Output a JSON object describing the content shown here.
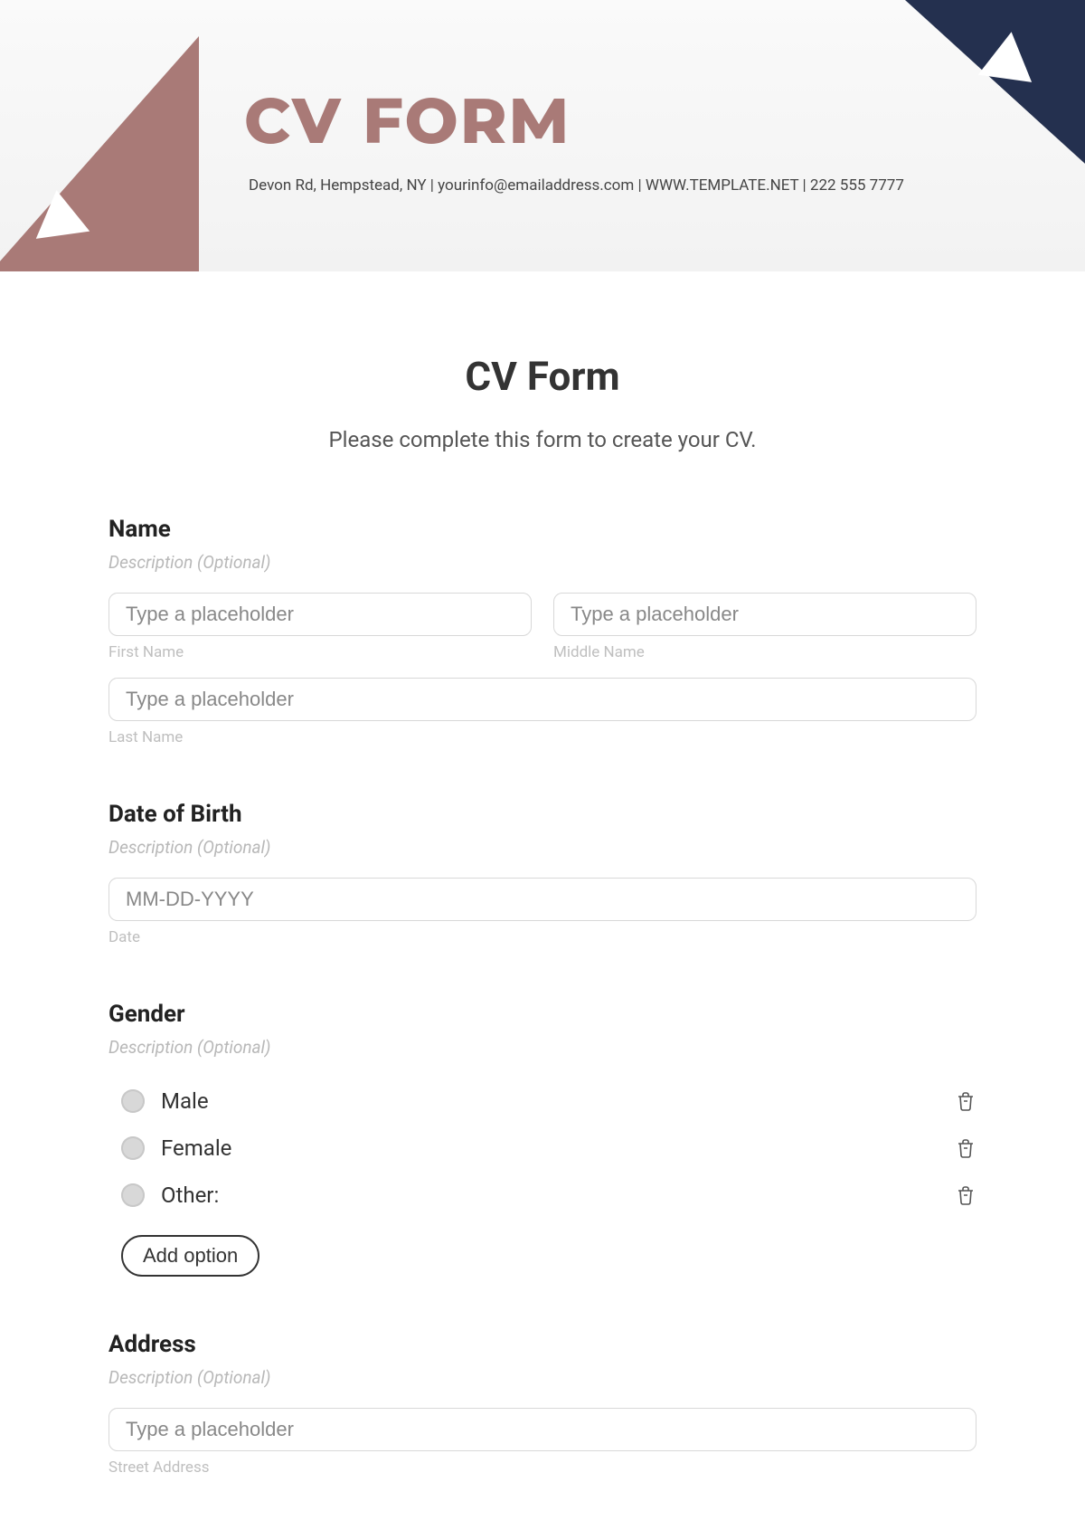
{
  "banner": {
    "title": "CV FORM",
    "sub": "Devon Rd, Hempstead, NY | yourinfo@emailaddress.com | WWW.TEMPLATE.NET | 222 555 7777"
  },
  "form": {
    "title": "CV Form",
    "sub": "Please complete this form to create your CV."
  },
  "name": {
    "label": "Name",
    "desc": "Description (Optional)",
    "first_placeholder": "Type a placeholder",
    "first_sub": "First Name",
    "middle_placeholder": "Type a placeholder",
    "middle_sub": "Middle Name",
    "last_placeholder": "Type a placeholder",
    "last_sub": "Last Name"
  },
  "dob": {
    "label": "Date of Birth",
    "desc": "Description (Optional)",
    "placeholder": "MM-DD-YYYY",
    "sub": "Date"
  },
  "gender": {
    "label": "Gender",
    "desc": "Description (Optional)",
    "options": [
      "Male",
      "Female",
      "Other:"
    ],
    "add": "Add option"
  },
  "address": {
    "label": "Address",
    "desc": "Description (Optional)",
    "street_placeholder": "Type a placeholder",
    "street_sub": "Street Address"
  }
}
